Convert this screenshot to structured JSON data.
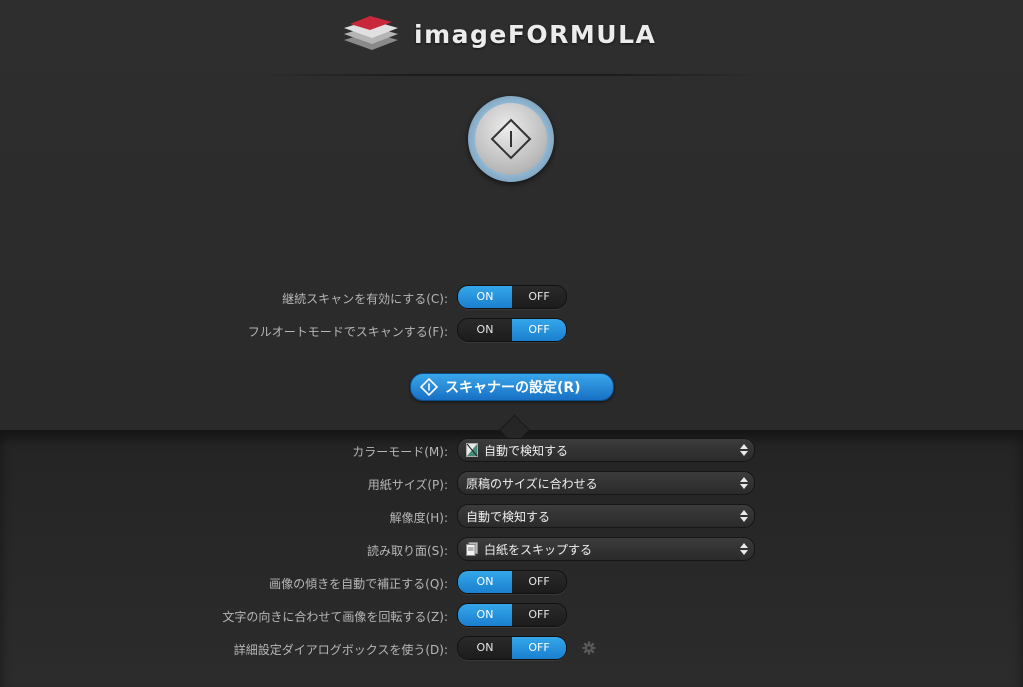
{
  "header": {
    "brand": "imageFORMULA"
  },
  "scan_button": {
    "icon": "scan-start-icon"
  },
  "top_options": [
    {
      "label": "継続スキャンを有効にする(C):",
      "on_label": "ON",
      "off_label": "OFF",
      "value": "on"
    },
    {
      "label": "フルオートモードでスキャンする(F):",
      "on_label": "ON",
      "off_label": "OFF",
      "value": "off"
    }
  ],
  "scanner_settings_button": {
    "label": "スキャナーの設定(R)"
  },
  "settings": {
    "color_mode": {
      "label": "カラーモード(M):",
      "value": "自動で検知する",
      "icon": "color-mode-icon"
    },
    "paper_size": {
      "label": "用紙サイズ(P):",
      "value": "原稿のサイズに合わせる"
    },
    "resolution": {
      "label": "解像度(H):",
      "value": "自動で検知する"
    },
    "scan_side": {
      "label": "読み取り面(S):",
      "value": "白紙をスキップする",
      "icon": "page-side-icon"
    },
    "deskew": {
      "label": "画像の傾きを自動で補正する(Q):",
      "on_label": "ON",
      "off_label": "OFF",
      "value": "on"
    },
    "rotate": {
      "label": "文字の向きに合わせて画像を回転する(Z):",
      "on_label": "ON",
      "off_label": "OFF",
      "value": "on"
    },
    "advanced_dialog": {
      "label": "詳細設定ダイアログボックスを使う(D):",
      "on_label": "ON",
      "off_label": "OFF",
      "value": "off",
      "icon": "gear-icon"
    }
  },
  "colors": {
    "accent": "#1f8ad9",
    "background": "#2b2b2b"
  }
}
